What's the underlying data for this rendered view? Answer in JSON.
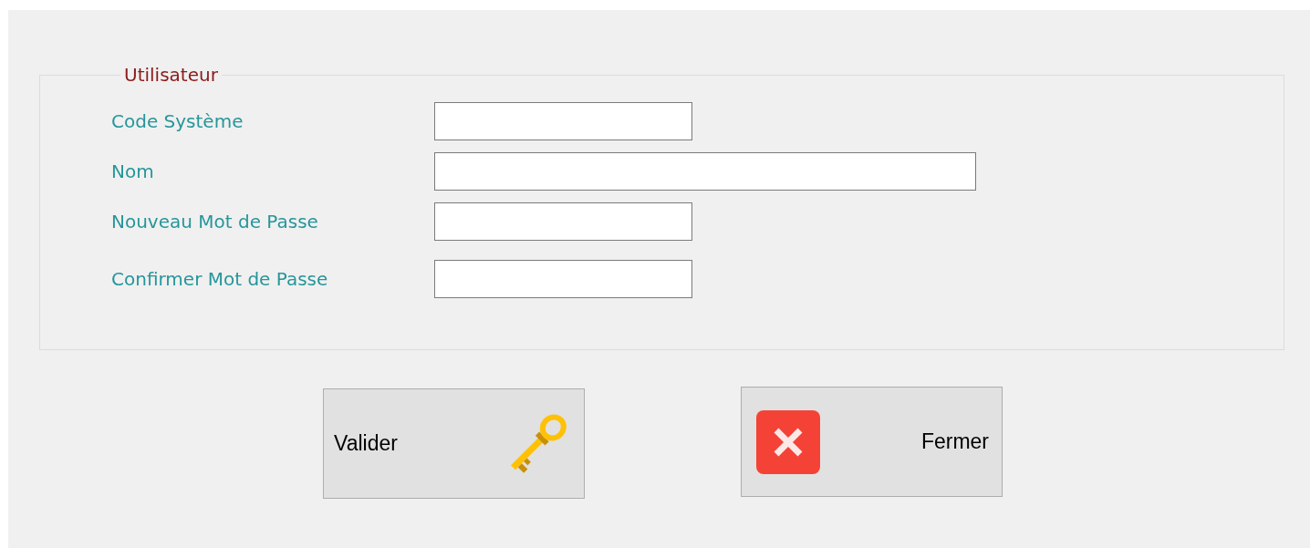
{
  "group": {
    "title": "Utilisateur"
  },
  "fields": [
    {
      "label": "Code Système",
      "kind": "short"
    },
    {
      "label": "Nom",
      "kind": "long"
    },
    {
      "label": "Nouveau Mot de Passe",
      "kind": "short"
    },
    {
      "label": "Confirmer Mot de Passe",
      "kind": "short"
    }
  ],
  "buttons": [
    {
      "label": "Valider",
      "kind": "confirm"
    },
    {
      "label": "Fermer",
      "kind": "close"
    }
  ]
}
